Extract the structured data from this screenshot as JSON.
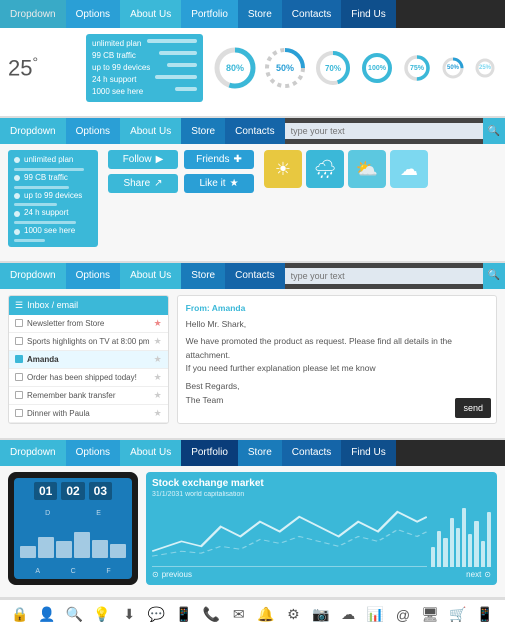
{
  "nav1": {
    "items": [
      {
        "label": "Dropdown",
        "style": "active"
      },
      {
        "label": "Options",
        "style": "blue1"
      },
      {
        "label": "About Us",
        "style": ""
      },
      {
        "label": "Portfolio",
        "style": ""
      },
      {
        "label": "Store",
        "style": ""
      },
      {
        "label": "Contacts",
        "style": ""
      },
      {
        "label": "Find Us",
        "style": ""
      }
    ]
  },
  "nav2": {
    "items": [
      {
        "label": "Dropdown",
        "style": "active"
      },
      {
        "label": "Options",
        "style": "blue1"
      },
      {
        "label": "About Us",
        "style": "blue2"
      },
      {
        "label": "Store",
        "style": ""
      },
      {
        "label": "Contacts",
        "style": ""
      }
    ],
    "search_placeholder": "type your text"
  },
  "nav3": {
    "items": [
      {
        "label": "Dropdown",
        "style": "active"
      },
      {
        "label": "Options",
        "style": "blue1"
      },
      {
        "label": "About Us",
        "style": "blue2"
      },
      {
        "label": "Store",
        "style": ""
      },
      {
        "label": "Contacts",
        "style": ""
      }
    ],
    "search_placeholder": "type your text"
  },
  "nav4": {
    "items": [
      {
        "label": "Dropdown",
        "style": "active"
      },
      {
        "label": "Options",
        "style": "blue1"
      },
      {
        "label": "About Us",
        "style": "blue2"
      },
      {
        "label": "Portfolio",
        "style": "active"
      },
      {
        "label": "Store",
        "style": ""
      },
      {
        "label": "Contacts",
        "style": ""
      },
      {
        "label": "Find Us",
        "style": ""
      }
    ]
  },
  "weather": {
    "temp": "25",
    "degree": "°"
  },
  "infopanel": {
    "lines": [
      {
        "label": "unlimited plan",
        "bar": 80
      },
      {
        "label": "99 CB traffic",
        "bar": 60
      },
      {
        "label": "up to 99 devices",
        "bar": 50
      },
      {
        "label": "24 h support",
        "bar": 70
      },
      {
        "label": "1000 see here",
        "bar": 40
      }
    ]
  },
  "donuts": [
    {
      "pct": 80,
      "color": "#3bb8d8",
      "size": 44
    },
    {
      "pct": 50,
      "color": "#2a9fd6",
      "size": 44
    },
    {
      "pct": 70,
      "color": "#3bb8d8",
      "size": 40
    },
    {
      "pct": 100,
      "color": "#3bb8d8",
      "size": 36
    },
    {
      "pct": 75,
      "color": "#3bb8d8",
      "size": 32
    },
    {
      "pct": 50,
      "color": "#2a9fd6",
      "size": 28
    },
    {
      "pct": 25,
      "color": "#7dd8f0",
      "size": 24
    }
  ],
  "social": {
    "follow": "Follow",
    "friends": "Friends",
    "share": "Share",
    "likeit": "Like it"
  },
  "email": {
    "header": "Inbox / email",
    "items": [
      {
        "text": "Newsletter from Store",
        "starred": true,
        "unread": false
      },
      {
        "text": "Sports highlights on TV at 8:00 pm",
        "starred": false,
        "unread": false
      },
      {
        "text": "Amanda",
        "starred": false,
        "unread": true
      },
      {
        "text": "Order has been shipped today!",
        "starred": false,
        "unread": false
      },
      {
        "text": "Remember bank transfer",
        "starred": false,
        "unread": false
      },
      {
        "text": "Dinner with Paula",
        "starred": false,
        "unread": false
      }
    ],
    "from": "From: Amanda",
    "greeting": "Hello Mr. Shark,",
    "body1": "We have promoted the product as request. Please find all details in the attachment.",
    "body2": "If you need further explanation please let me know",
    "closing": "Best Regards,",
    "signature": "The Team",
    "send_label": "send"
  },
  "stock": {
    "title": "Stock exchange market",
    "subtitle": "31/1/2031 world capitalisation",
    "prev_label": "previous",
    "next_label": "next"
  },
  "tablet": {
    "counters": [
      "01",
      "02",
      "03"
    ],
    "labels": [
      "A",
      "C",
      "F"
    ]
  },
  "icons": [
    "🔒",
    "👤",
    "🔍",
    "💡",
    "⬇",
    "💬",
    "📱",
    "📞",
    "✉",
    "🔔",
    "⚙",
    "📷",
    "☁",
    "📊",
    "@",
    "🖥",
    "🛒",
    "📱"
  ]
}
